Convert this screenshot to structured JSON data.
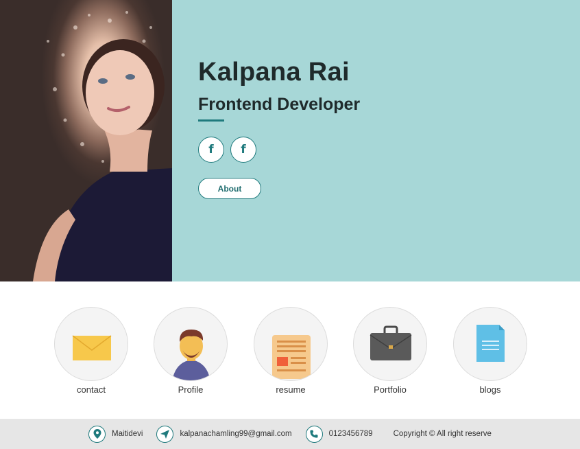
{
  "hero": {
    "name": "Kalpana Rai",
    "role": "Frontend Developer",
    "socials": [
      {
        "icon": "facebook-icon",
        "glyph": "f"
      },
      {
        "icon": "facebook-icon",
        "glyph": "f"
      }
    ],
    "about_label": "About",
    "background_color": "#a7d7d7",
    "accent_color": "#1f7a7d"
  },
  "cards": [
    {
      "label": "contact",
      "icon": "envelope-icon"
    },
    {
      "label": "Profile",
      "icon": "avatar-icon"
    },
    {
      "label": "resume",
      "icon": "document-icon"
    },
    {
      "label": "Portfolio",
      "icon": "briefcase-icon"
    },
    {
      "label": "blogs",
      "icon": "file-icon"
    }
  ],
  "footer": {
    "location": "Maitidevi",
    "email": "kalpanachamling99@gmail.com",
    "phone": "0123456789",
    "copyright": "Copyright © All right reserve"
  }
}
